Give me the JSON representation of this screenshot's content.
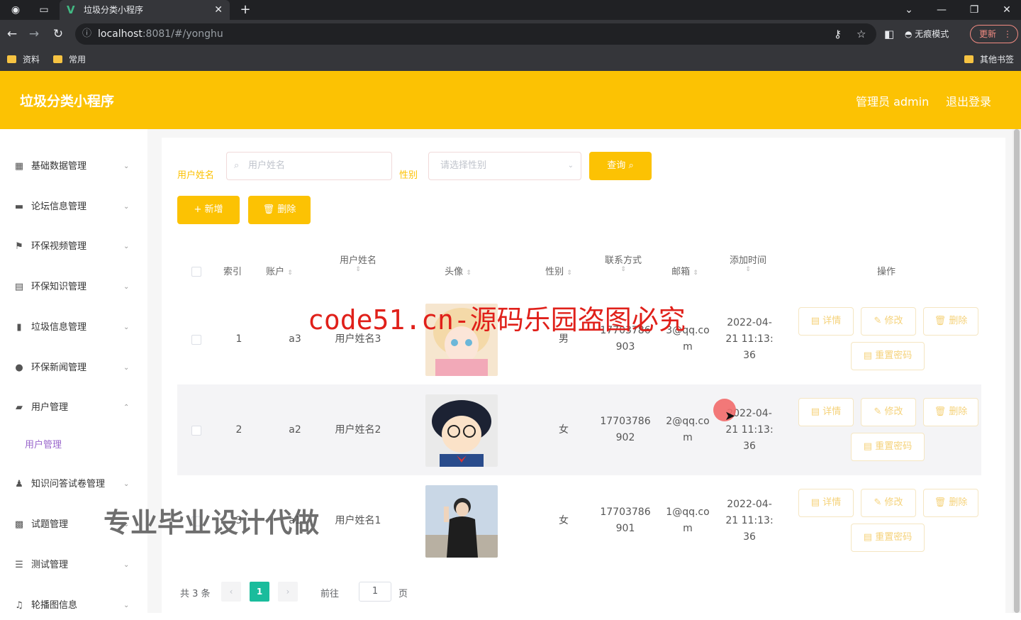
{
  "browser": {
    "tab_title": "垃圾分类小程序",
    "url_host": "localhost",
    "url_rest": ":8081/#/yonghu",
    "incognito_label": "无痕模式",
    "update_label": "更新",
    "bookmarks": [
      "资料",
      "常用"
    ],
    "other_bookmarks": "其他书签"
  },
  "header": {
    "title": "垃圾分类小程序",
    "admin_label": "管理员 admin",
    "logout_label": "退出登录"
  },
  "sidebar": {
    "items": [
      {
        "label": "基础数据管理",
        "icon": "grid-icon"
      },
      {
        "label": "论坛信息管理",
        "icon": "monitor-icon"
      },
      {
        "label": "环保视频管理",
        "icon": "flag-icon"
      },
      {
        "label": "环保知识管理",
        "icon": "document-icon"
      },
      {
        "label": "垃圾信息管理",
        "icon": "bar-chart-icon"
      },
      {
        "label": "环保新闻管理",
        "icon": "bulb-icon"
      },
      {
        "label": "用户管理",
        "icon": "chat-icon"
      },
      {
        "label": "知识问答试卷管理",
        "icon": "user-icon"
      },
      {
        "label": "试题管理",
        "icon": "keyboard-icon"
      },
      {
        "label": "测试管理",
        "icon": "list-icon"
      },
      {
        "label": "轮播图信息",
        "icon": "mic-icon"
      }
    ],
    "sub_item": "用户管理"
  },
  "search": {
    "name_label": "用户姓名",
    "name_placeholder": "用户姓名",
    "gender_label": "性别",
    "gender_placeholder": "请选择性别",
    "query_button": "查询",
    "add_button": "+ 新增",
    "delete_button": "删除"
  },
  "table": {
    "headers": {
      "index": "索引",
      "account": "账户",
      "name": "用户姓名",
      "avatar": "头像",
      "gender": "性别",
      "phone": "联系方式",
      "email": "邮箱",
      "time": "添加时间",
      "ops": "操作"
    },
    "rows": [
      {
        "index": "1",
        "account": "a3",
        "name": "用户姓名3",
        "gender": "男",
        "phone1": "17703786",
        "phone2": "903",
        "email1": "3@qq.co",
        "email2": "m",
        "time1": "2022-04-",
        "time2": "21 11:13:",
        "time3": "36"
      },
      {
        "index": "2",
        "account": "a2",
        "name": "用户姓名2",
        "gender": "女",
        "phone1": "17703786",
        "phone2": "902",
        "email1": "2@qq.co",
        "email2": "m",
        "time1": "2022-04-",
        "time2": "21 11:13:",
        "time3": "36"
      },
      {
        "index": "3",
        "account": "a1",
        "name": "用户姓名1",
        "gender": "女",
        "phone1": "17703786",
        "phone2": "901",
        "email1": "1@qq.co",
        "email2": "m",
        "time1": "2022-04-",
        "time2": "21 11:13:",
        "time3": "36"
      }
    ],
    "op_labels": {
      "detail": "详情",
      "edit": "修改",
      "delete": "删除",
      "reset": "重置密码"
    }
  },
  "pagination": {
    "total": "共 3 条",
    "current_page": "1",
    "goto_label": "前往",
    "goto_value": "1",
    "page_suffix": "页"
  },
  "overlays": {
    "red_watermark": "code51.cn-源码乐园盗图必究",
    "ad_text": "专业毕业设计代做"
  },
  "colors": {
    "brand": "#fcc203",
    "pagination_active": "#1abc9c",
    "watermark_red": "#e0201a"
  }
}
